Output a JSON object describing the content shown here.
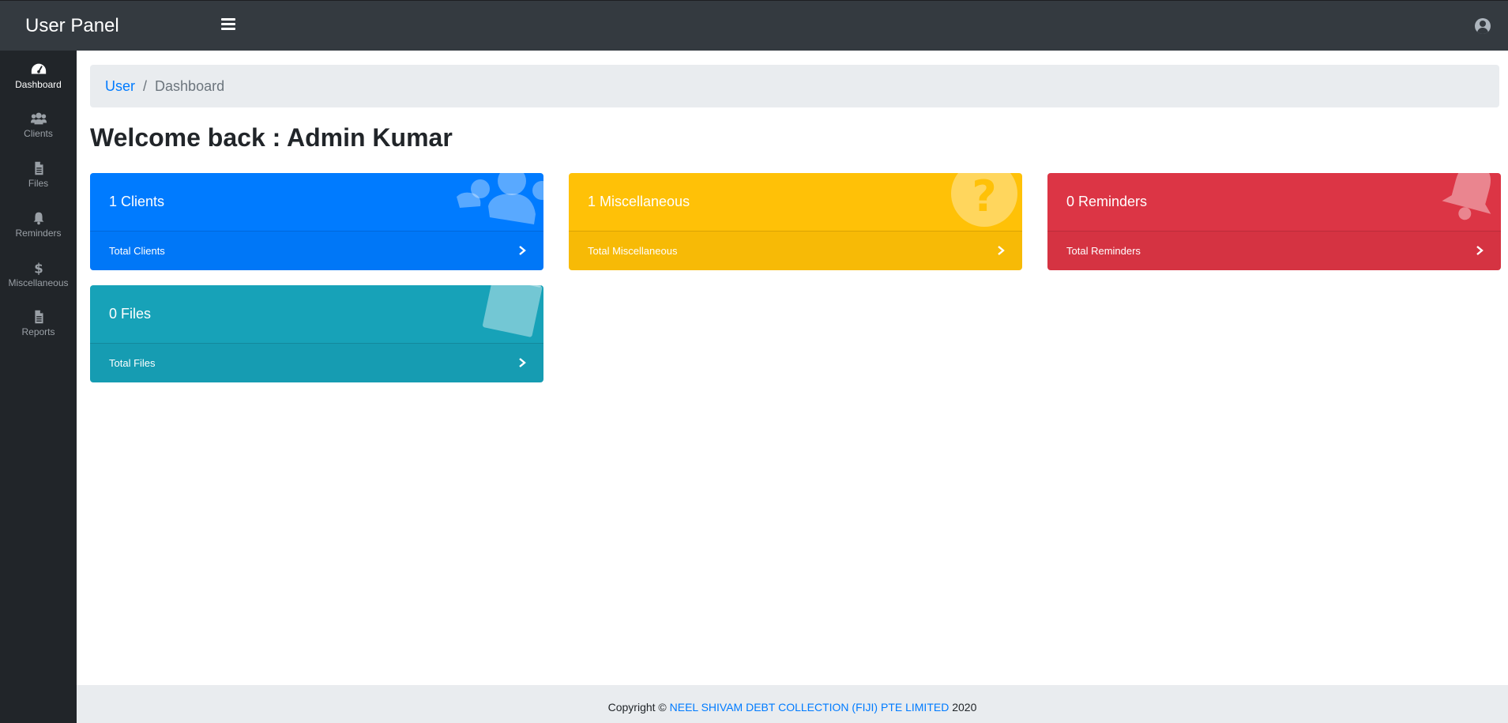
{
  "topbar": {
    "brand": "User Panel"
  },
  "sidebar": {
    "items": [
      {
        "label": "Dashboard",
        "icon": "tachometer-icon",
        "active": true
      },
      {
        "label": "Clients",
        "icon": "users-icon"
      },
      {
        "label": "Files",
        "icon": "file-icon"
      },
      {
        "label": "Reminders",
        "icon": "bell-icon"
      },
      {
        "label": "Miscellaneous",
        "icon": "dollar-icon"
      },
      {
        "label": "Reports",
        "icon": "file-icon"
      }
    ]
  },
  "breadcrumb": {
    "link": "User",
    "separator": "/",
    "current": "Dashboard"
  },
  "welcome": "Welcome back : Admin Kumar",
  "cards": [
    {
      "title": "1 Clients",
      "footer": "Total Clients",
      "color": "#007bff",
      "icon": "users-icon"
    },
    {
      "title": "1 Miscellaneous",
      "footer": "Total Miscellaneous",
      "color": "#ffc107",
      "icon": "question-circle-icon"
    },
    {
      "title": "0 Reminders",
      "footer": "Total Reminders",
      "color": "#dc3545",
      "icon": "bell-icon"
    },
    {
      "title": "0 Files",
      "footer": "Total Files",
      "color": "#17a2b8",
      "icon": "clipboard-icon"
    }
  ],
  "footer": {
    "prefix": "Copyright ©",
    "company": "NEEL SHIVAM DEBT COLLECTION (FIJI) PTE LIMITED",
    "year": "2020"
  }
}
